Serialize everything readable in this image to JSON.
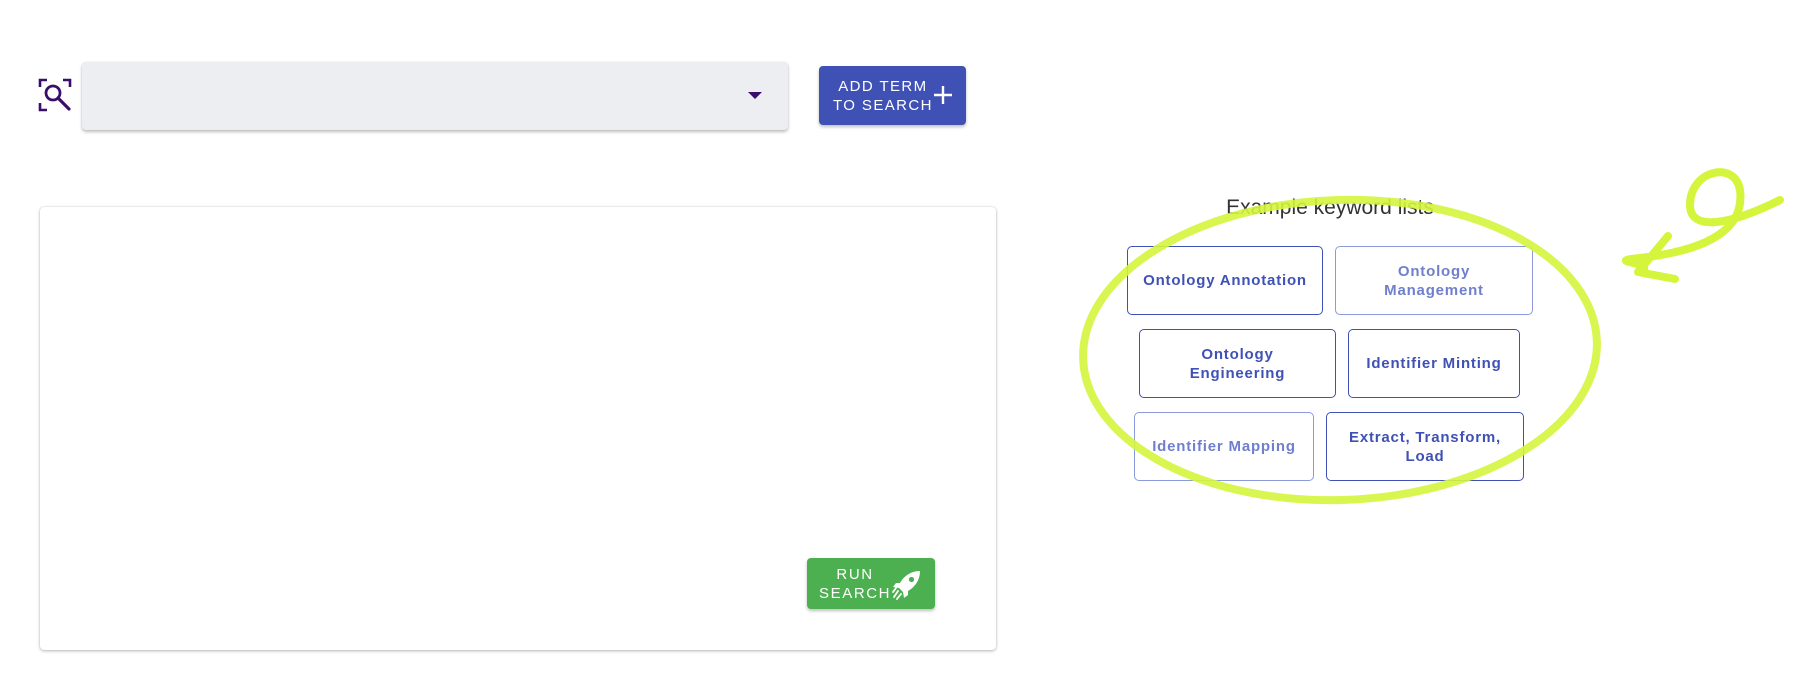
{
  "search": {
    "icon": "search-scan-icon",
    "select_value": "",
    "add_button_label": "ADD TERM\nTO SEARCH",
    "add_icon": "plus-icon"
  },
  "editor": {
    "content": "",
    "run_button_label": "RUN\nSEARCH",
    "run_icon": "rocket-icon"
  },
  "examples": {
    "title": "Example keyword lists",
    "items": [
      {
        "label": "Ontology Annotation"
      },
      {
        "label": "Ontology Management"
      },
      {
        "label": "Ontology Engineering"
      },
      {
        "label": "Identifier Minting"
      },
      {
        "label": "Identifier Mapping"
      },
      {
        "label": "Extract, Transform, Load"
      }
    ]
  },
  "colors": {
    "primary": "#3f51b5",
    "success": "#4caf50",
    "annotation_highlight": "#d4f53c",
    "select_background": "#eceef1"
  }
}
